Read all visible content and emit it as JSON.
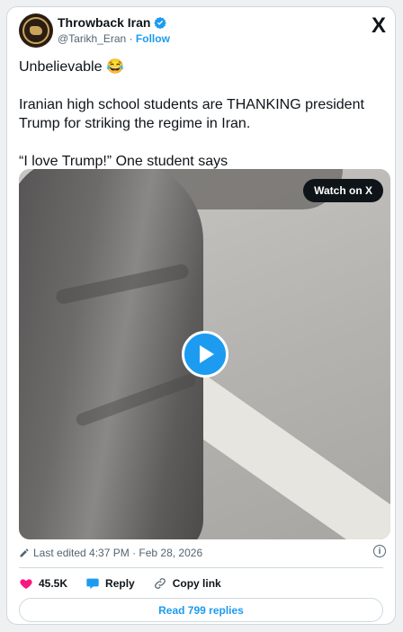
{
  "author": {
    "name": "Throwback Iran",
    "handle": "@Tarikh_Eran",
    "separator": "·",
    "follow_label": "Follow",
    "verified": true
  },
  "brand": {
    "logo_glyph": "X"
  },
  "tweet": {
    "line1": "Unbelievable 😂",
    "line2": "Iranian high school students are THANKING president Trump for striking the regime in Iran.",
    "line3": "“I love Trump!” One student says"
  },
  "media": {
    "watch_label": "Watch on X",
    "play_icon": "play-icon"
  },
  "meta": {
    "edited_text": "Last edited 4:37 PM · Feb 28, 2026"
  },
  "actions": {
    "likes": "45.5K",
    "reply_label": "Reply",
    "copy_link_label": "Copy link",
    "read_replies_label": "Read 799 replies"
  },
  "colors": {
    "accent": "#1d9bf0",
    "like": "#f91880",
    "text": "#0f1419",
    "muted": "#536471"
  }
}
